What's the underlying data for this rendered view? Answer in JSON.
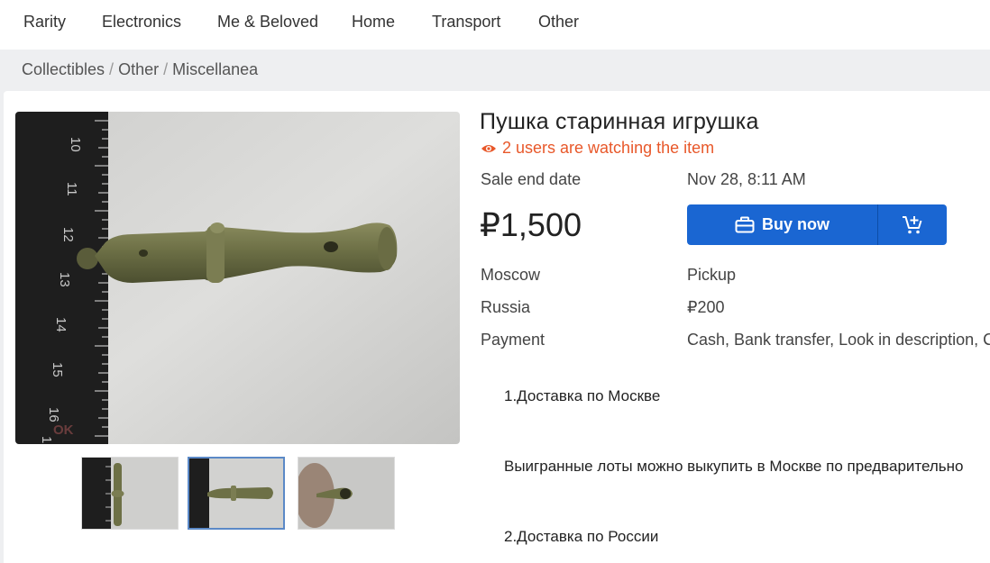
{
  "nav": {
    "items": [
      "Rarity",
      "Electronics",
      "Me & Beloved",
      "Home",
      "Transport",
      "Other"
    ]
  },
  "breadcrumb": [
    "Collectibles",
    "Other",
    "Miscellanea"
  ],
  "item": {
    "title": "Пушка старинная игрушка",
    "watchers": "2 users are watching the item",
    "sale_end_label": "Sale end date",
    "sale_end_value": "Nov 28, 8:11 AM",
    "price": "₽1,500",
    "buy_now_label": "Buy now",
    "location_city": "Moscow",
    "delivery_method": "Pickup",
    "location_country": "Russia",
    "delivery_cost": "₽200",
    "payment_label": "Payment",
    "payment_value": "Cash, Bank transfer, Look in description, Co"
  },
  "description": {
    "line1": "1.Доставка по Москве",
    "line2": "Выигранные лоты можно выкупить в Москве по предварительно",
    "line3": "2.Доставка по России"
  },
  "gallery": {
    "watermark": "OK",
    "active_index": 1
  },
  "colors": {
    "accent": "#1a66d2",
    "watch_orange": "#e8582a"
  },
  "icons": {
    "watch": "eye-icon",
    "buy": "briefcase-icon",
    "cart": "add-to-cart-icon"
  }
}
